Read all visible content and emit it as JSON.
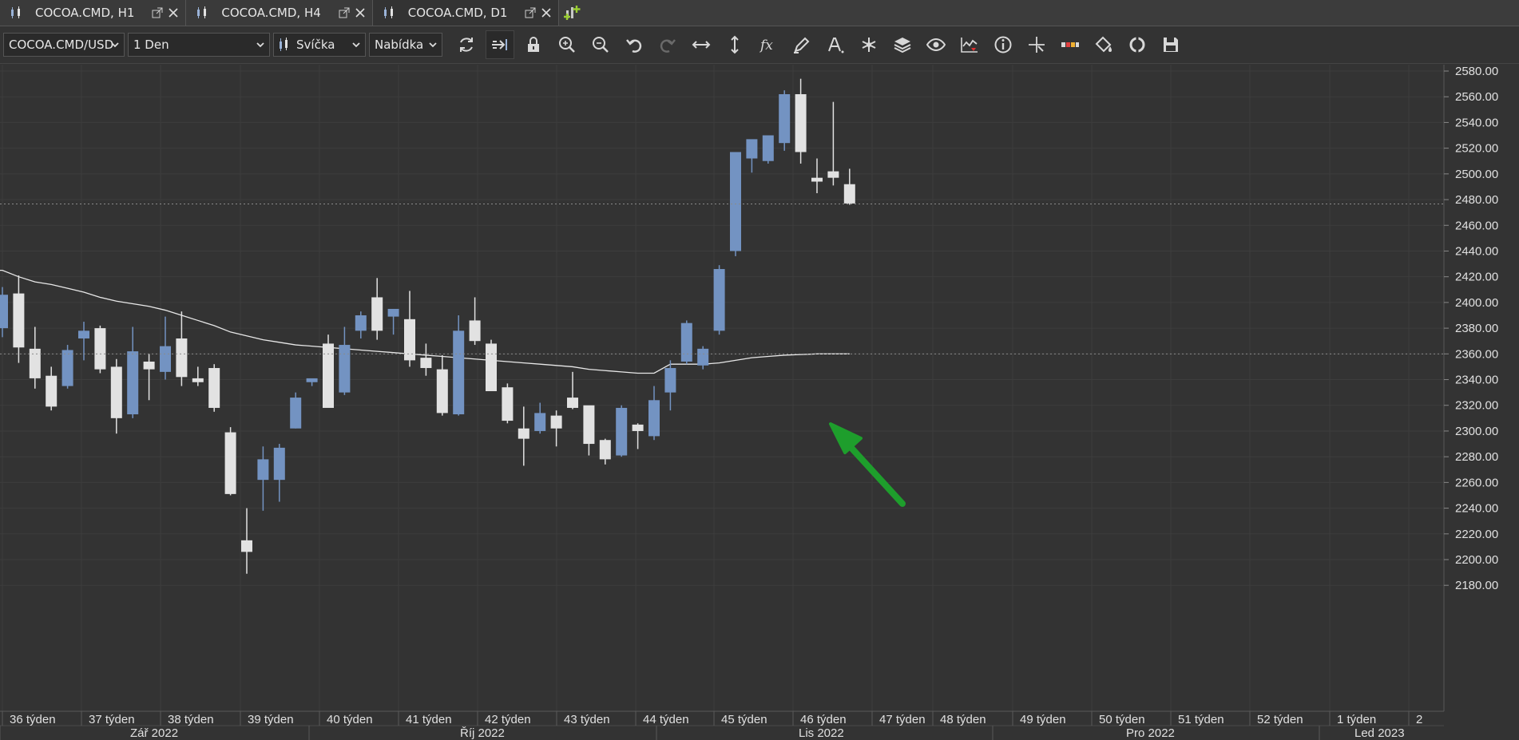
{
  "tabs": [
    {
      "title": "COCOA.CMD, H1",
      "active": false
    },
    {
      "title": "COCOA.CMD, H4",
      "active": false
    },
    {
      "title": "COCOA.CMD, D1",
      "active": true
    }
  ],
  "toolbar": {
    "instrument": "COCOA.CMD/USD",
    "period": "1 Den",
    "chart_type": "Svíčka",
    "price_side": "Nabídka",
    "icons": [
      "refresh-icon",
      "shift-chart-icon",
      "lock-icon",
      "zoom-in-icon",
      "zoom-out-icon",
      "undo-icon",
      "redo-icon",
      "horizontal-scale-icon",
      "vertical-scale-icon",
      "indicators-icon",
      "pencil-icon",
      "text-icon",
      "pattern-icon",
      "layers-icon",
      "eye-icon",
      "alert-icon",
      "info-icon",
      "crosshair-icon",
      "color-scheme-icon",
      "paint-bucket-icon",
      "sync-icon",
      "save-icon"
    ]
  },
  "colors": {
    "background": "#333333",
    "bull": "#7393c2",
    "bear": "#e2e2e2",
    "ma_line": "#e8e8e8",
    "grid": "#3d3d3d",
    "arrow": "#1e9e2c",
    "last_price_label": "#9ab3d8"
  },
  "chart_data": {
    "type": "candlestick",
    "yticks": [
      2180.0,
      2200.0,
      2220.0,
      2240.0,
      2260.0,
      2280.0,
      2300.0,
      2320.0,
      2340.0,
      2360.0,
      2380.0,
      2400.0,
      2420.0,
      2440.0,
      2460.0,
      2480.0,
      2500.0,
      2520.0,
      2540.0,
      2560.0,
      2580.0
    ],
    "ylim": [
      2180,
      2584
    ],
    "xlabels_weeks": [
      "36 týden",
      "37 týden",
      "38 týden",
      "39 týden",
      "40 týden",
      "41 týden",
      "42 týden",
      "43 týden",
      "44 týden",
      "45 týden",
      "46 týden",
      "47 týden",
      "48 týden",
      "49 týden",
      "50 týden",
      "51 týden",
      "52 týden",
      "1 týden",
      "2"
    ],
    "xlabels_months": [
      "Zář 2022",
      "Říj 2022",
      "Lis 2022",
      "Pro 2022",
      "Led 2023"
    ],
    "price_labels": {
      "last": "2476.656",
      "ma": "2359.979"
    },
    "last_price": 2476.656,
    "ma_value": 2359.979,
    "candles": [
      {
        "o": 2380,
        "h": 2412,
        "l": 2373,
        "c": 2406
      },
      {
        "o": 2407,
        "h": 2421,
        "l": 2353,
        "c": 2365
      },
      {
        "o": 2364,
        "h": 2381,
        "l": 2333,
        "c": 2341
      },
      {
        "o": 2343,
        "h": 2350,
        "l": 2316,
        "c": 2319
      },
      {
        "o": 2335,
        "h": 2367,
        "l": 2333,
        "c": 2363
      },
      {
        "o": 2372,
        "h": 2385,
        "l": 2355,
        "c": 2378
      },
      {
        "o": 2380,
        "h": 2382,
        "l": 2345,
        "c": 2348
      },
      {
        "o": 2350,
        "h": 2356,
        "l": 2298,
        "c": 2310
      },
      {
        "o": 2313,
        "h": 2381,
        "l": 2310,
        "c": 2362
      },
      {
        "o": 2354,
        "h": 2360,
        "l": 2324,
        "c": 2348
      },
      {
        "o": 2346,
        "h": 2389,
        "l": 2340,
        "c": 2366
      },
      {
        "o": 2372,
        "h": 2393,
        "l": 2335,
        "c": 2342
      },
      {
        "o": 2341,
        "h": 2350,
        "l": 2335,
        "c": 2338
      },
      {
        "o": 2349,
        "h": 2352,
        "l": 2315,
        "c": 2318
      },
      {
        "o": 2299,
        "h": 2303,
        "l": 2250,
        "c": 2251
      },
      {
        "o": 2215,
        "h": 2240,
        "l": 2189,
        "c": 2206
      },
      {
        "o": 2262,
        "h": 2288,
        "l": 2238,
        "c": 2278
      },
      {
        "o": 2262,
        "h": 2290,
        "l": 2245,
        "c": 2287
      },
      {
        "o": 2302,
        "h": 2330,
        "l": 2302,
        "c": 2326
      },
      {
        "o": 2338,
        "h": 2340,
        "l": 2335,
        "c": 2341
      },
      {
        "o": 2368,
        "h": 2375,
        "l": 2320,
        "c": 2318
      },
      {
        "o": 2330,
        "h": 2381,
        "l": 2328,
        "c": 2367
      },
      {
        "o": 2378,
        "h": 2393,
        "l": 2372,
        "c": 2390
      },
      {
        "o": 2404,
        "h": 2419,
        "l": 2371,
        "c": 2378
      },
      {
        "o": 2389,
        "h": 2393,
        "l": 2375,
        "c": 2395
      },
      {
        "o": 2387,
        "h": 2409,
        "l": 2350,
        "c": 2355
      },
      {
        "o": 2357,
        "h": 2368,
        "l": 2343,
        "c": 2349
      },
      {
        "o": 2348,
        "h": 2359,
        "l": 2312,
        "c": 2314
      },
      {
        "o": 2313,
        "h": 2390,
        "l": 2312,
        "c": 2378
      },
      {
        "o": 2386,
        "h": 2404,
        "l": 2367,
        "c": 2370
      },
      {
        "o": 2368,
        "h": 2371,
        "l": 2342,
        "c": 2331
      },
      {
        "o": 2334,
        "h": 2337,
        "l": 2306,
        "c": 2308
      },
      {
        "o": 2302,
        "h": 2319,
        "l": 2273,
        "c": 2294
      },
      {
        "o": 2300,
        "h": 2322,
        "l": 2298,
        "c": 2314
      },
      {
        "o": 2312,
        "h": 2316,
        "l": 2288,
        "c": 2302
      },
      {
        "o": 2326,
        "h": 2346,
        "l": 2317,
        "c": 2318
      },
      {
        "o": 2320,
        "h": 2319,
        "l": 2281,
        "c": 2290
      },
      {
        "o": 2293,
        "h": 2294,
        "l": 2274,
        "c": 2278
      },
      {
        "o": 2281,
        "h": 2320,
        "l": 2280,
        "c": 2318
      },
      {
        "o": 2305,
        "h": 2306,
        "l": 2286,
        "c": 2300
      },
      {
        "o": 2296,
        "h": 2335,
        "l": 2293,
        "c": 2324
      },
      {
        "o": 2330,
        "h": 2355,
        "l": 2316,
        "c": 2349
      },
      {
        "o": 2354,
        "h": 2386,
        "l": 2352,
        "c": 2384
      },
      {
        "o": 2351,
        "h": 2366,
        "l": 2348,
        "c": 2364
      },
      {
        "o": 2378,
        "h": 2429,
        "l": 2375,
        "c": 2426
      },
      {
        "o": 2440,
        "h": 2456,
        "l": 2436,
        "c": 2517
      },
      {
        "o": 2512,
        "h": 2525,
        "l": 2501,
        "c": 2527
      },
      {
        "o": 2510,
        "h": 2524,
        "l": 2508,
        "c": 2530
      },
      {
        "o": 2524,
        "h": 2565,
        "l": 2518,
        "c": 2562
      },
      {
        "o": 2562,
        "h": 2574,
        "l": 2508,
        "c": 2517
      },
      {
        "o": 2497,
        "h": 2512,
        "l": 2485,
        "c": 2494
      },
      {
        "o": 2502,
        "h": 2556,
        "l": 2491,
        "c": 2497
      },
      {
        "o": 2492,
        "h": 2504,
        "l": 2476,
        "c": 2477
      }
    ],
    "ma": [
      2425,
      2420,
      2416,
      2414,
      2411,
      2408,
      2404,
      2401,
      2399,
      2397,
      2394,
      2390,
      2386,
      2382,
      2377,
      2374,
      2371,
      2369,
      2367,
      2366,
      2365,
      2364,
      2363,
      2362,
      2361,
      2360,
      2359,
      2358,
      2357,
      2356,
      2355,
      2354,
      2353,
      2352,
      2351,
      2350,
      2348,
      2347,
      2346,
      2345,
      2345,
      2352,
      2352,
      2352,
      2353,
      2355,
      2357,
      2358,
      2359,
      2359.5,
      2360,
      2360,
      2360
    ]
  }
}
